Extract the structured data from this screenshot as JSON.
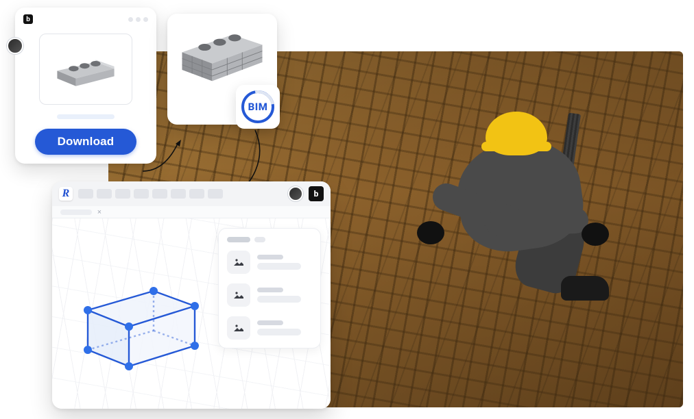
{
  "card_download": {
    "button_label": "Download"
  },
  "bim_badge": {
    "label": "BIM"
  },
  "revit_card": {
    "logo_letter": "R",
    "plugin_logo_letter": "b",
    "close_glyph": "×"
  },
  "brand_logo_letter": "b"
}
